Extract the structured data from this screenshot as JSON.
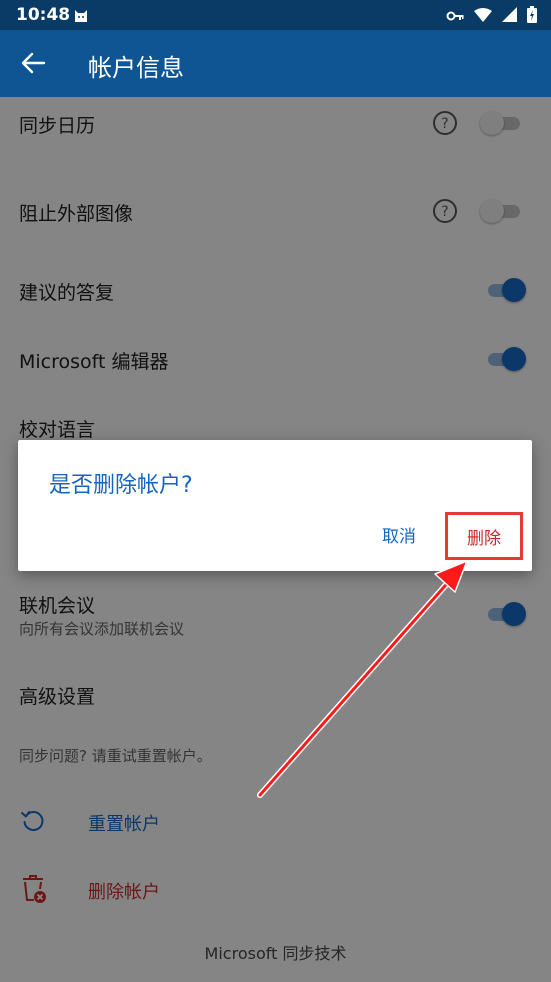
{
  "status_bar": {
    "time": "10:48"
  },
  "app_bar": {
    "title": "帐户信息"
  },
  "settings": {
    "sync_calendar": "同步日历",
    "block_external_images": "阻止外部图像",
    "suggested_replies": "建议的答复",
    "microsoft_editor": "Microsoft 编辑器",
    "proofing_language": "校对语言",
    "online_meeting": "联机会议",
    "online_meeting_desc": "向所有会议添加联机会议",
    "advanced_settings": "高级设置",
    "sync_issue_hint": "同步问题? 请重试重置帐户。",
    "reset_account": "重置帐户",
    "delete_account": "删除帐户",
    "footer": "Microsoft 同步技术"
  },
  "toggles": {
    "sync_calendar": "off",
    "block_external_images": "off",
    "suggested_replies": "on",
    "microsoft_editor": "on",
    "online_meeting": "on"
  },
  "dialog": {
    "title": "是否删除帐户?",
    "cancel_label": "取消",
    "delete_label": "删除"
  },
  "colors": {
    "status_bar": "#0a3b66",
    "app_bar": "#0f5594",
    "accent": "#1565c0",
    "danger": "#c62828",
    "highlight_box": "#e53935",
    "annotation_arrow": "#ff1a1a"
  }
}
